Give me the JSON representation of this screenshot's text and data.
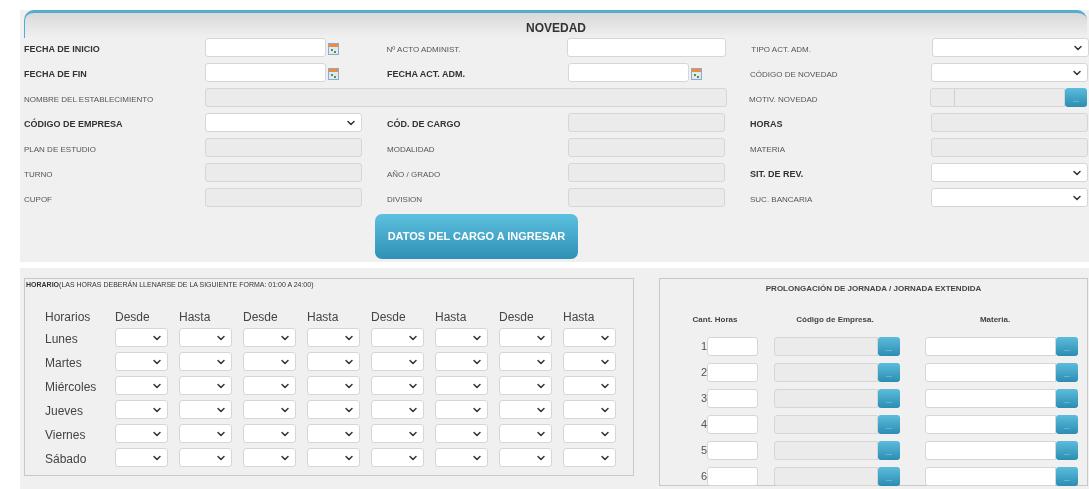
{
  "panel_title": "NOVEDAD",
  "form_rows": [
    [
      {
        "label": "FECHA DE INICIO",
        "bold": true,
        "kind": "date"
      },
      {
        "label": "Nº ACTO ADMINIST.",
        "bold": false,
        "kind": "text"
      },
      {
        "label": "TIPO ACT. ADM.",
        "bold": false,
        "kind": "select"
      }
    ],
    [
      {
        "label": "FECHA DE FIN",
        "bold": true,
        "kind": "date"
      },
      {
        "label": "FECHA ACT. ADM.",
        "bold": true,
        "kind": "date"
      },
      {
        "label": "CÓDIGO DE NOVEDAD",
        "bold": false,
        "kind": "select"
      }
    ],
    [
      {
        "label": "NOMBRE DEL ESTABLECIMIENTO",
        "bold": false,
        "kind": "wide"
      },
      {
        "label": "MOTIV. NOVEDAD",
        "bold": false,
        "kind": "lookup",
        "button": "..."
      }
    ],
    [
      {
        "label": "CÓDIGO DE EMPRESA",
        "bold": true,
        "kind": "select"
      },
      {
        "label": "CÓD. DE CARGO",
        "bold": true,
        "kind": "readonly"
      },
      {
        "label": "HORAS",
        "bold": true,
        "kind": "readonly"
      }
    ],
    [
      {
        "label": "PLAN DE ESTUDIO",
        "bold": false,
        "kind": "readonly"
      },
      {
        "label": "MODALIDAD",
        "bold": false,
        "kind": "readonly"
      },
      {
        "label": "MATERIA",
        "bold": false,
        "kind": "readonly"
      }
    ],
    [
      {
        "label": "TURNO",
        "bold": false,
        "kind": "readonly"
      },
      {
        "label": "AÑO / GRADO",
        "bold": false,
        "kind": "readonly"
      },
      {
        "label": "SIT. DE REV.",
        "bold": true,
        "kind": "select"
      }
    ],
    [
      {
        "label": "CUPOF",
        "bold": false,
        "kind": "readonly"
      },
      {
        "label": "DIVISION",
        "bold": false,
        "kind": "readonly"
      },
      {
        "label": "SUC. BANCARIA",
        "bold": false,
        "kind": "select"
      }
    ]
  ],
  "submit_button": "DATOS DEL CARGO A INGRESAR",
  "schedule": {
    "legend": "**HORARIO**(LAS HORAS DEBERÁN LLENARSE DE LA SIGUIENTE FORMA: 01:00 A 24:00)",
    "columns": [
      "Horarios",
      "Desde",
      "Hasta",
      "Desde",
      "Hasta",
      "Desde",
      "Hasta",
      "Desde",
      "Hasta"
    ],
    "days": [
      "Lunes",
      "Martes",
      "Miércoles",
      "Jueves",
      "Viernes",
      "Sábado"
    ]
  },
  "extension": {
    "title": "PROLONGACIÓN DE JORNADA / JORNADA EXTENDIDA",
    "columns": [
      "Cant. Horas",
      "Código de Empresa.",
      "Materia."
    ],
    "rows": [
      {
        "number": "1",
        "company_button": "...",
        "subject_button": "..."
      },
      {
        "number": "2",
        "company_button": "...",
        "subject_button": "..."
      },
      {
        "number": "3",
        "company_button": "...",
        "subject_button": "..."
      },
      {
        "number": "4",
        "company_button": "...",
        "subject_button": "..."
      },
      {
        "number": "5",
        "company_button": "...",
        "subject_button": "..."
      },
      {
        "number": "6",
        "company_button": "...",
        "subject_button": "..."
      }
    ]
  }
}
